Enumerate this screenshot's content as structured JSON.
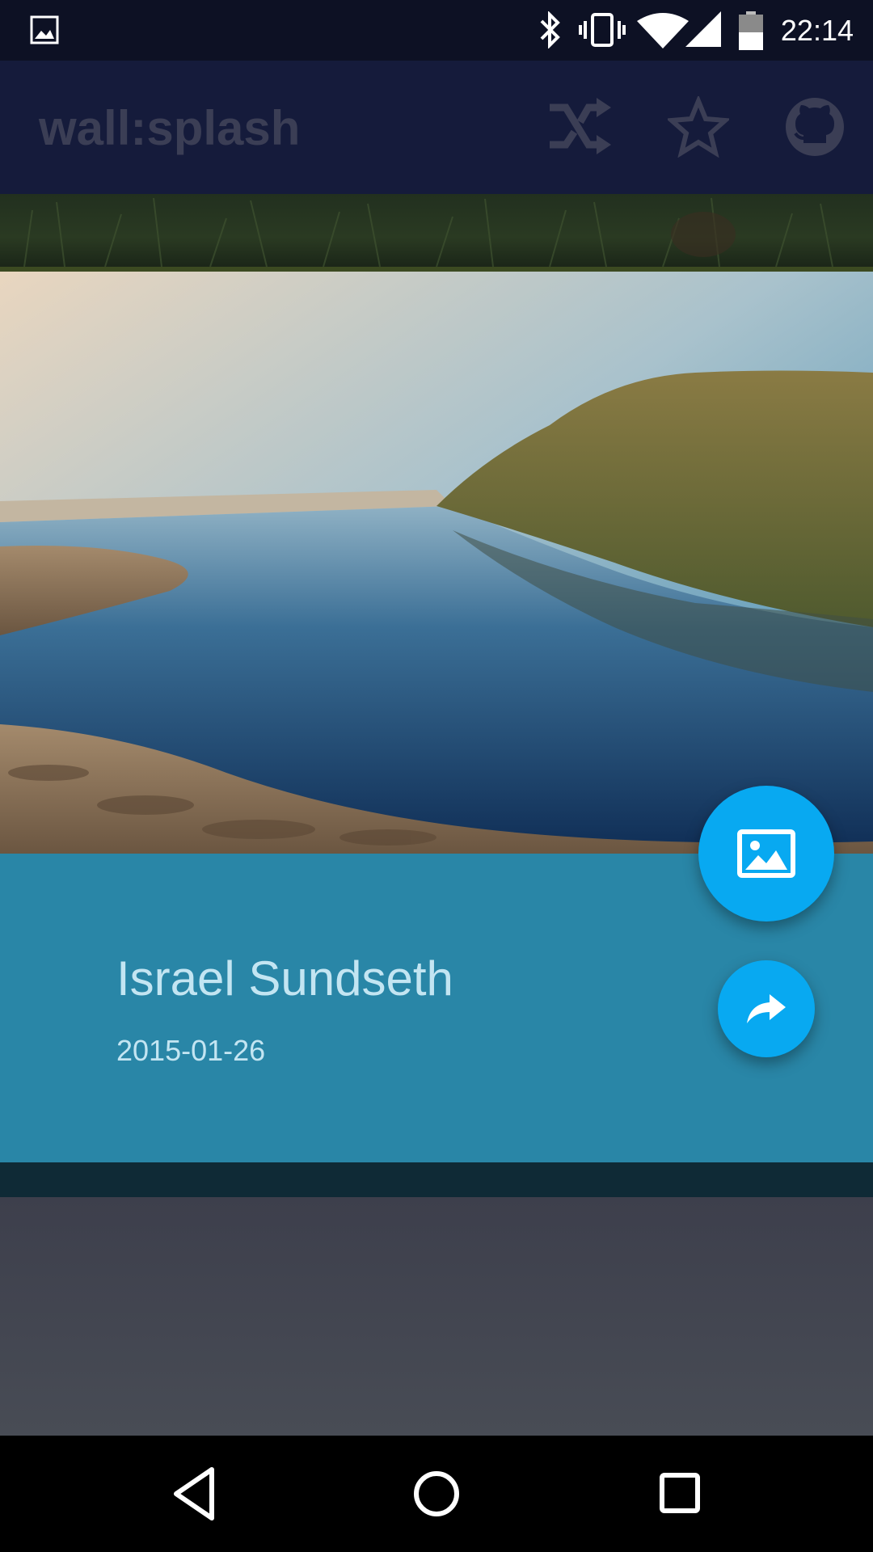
{
  "status_bar": {
    "time": "22:14",
    "icons": [
      "image-notification-icon",
      "bluetooth-icon",
      "vibrate-icon",
      "wifi-icon",
      "signal-icon",
      "battery-icon"
    ]
  },
  "app_bar": {
    "title": "wall:splash",
    "actions": [
      "shuffle-icon",
      "star-icon",
      "github-icon"
    ]
  },
  "photo": {
    "photographer": "Israel Sundseth",
    "date": "2015-01-26"
  },
  "fabs": [
    "set-wallpaper-icon",
    "share-icon"
  ],
  "nav_bar": [
    "back-icon",
    "home-icon",
    "recents-icon"
  ],
  "colors": {
    "app_bar": "#151b3b",
    "info_panel": "#2986a7",
    "fab": "#08a9f1"
  }
}
